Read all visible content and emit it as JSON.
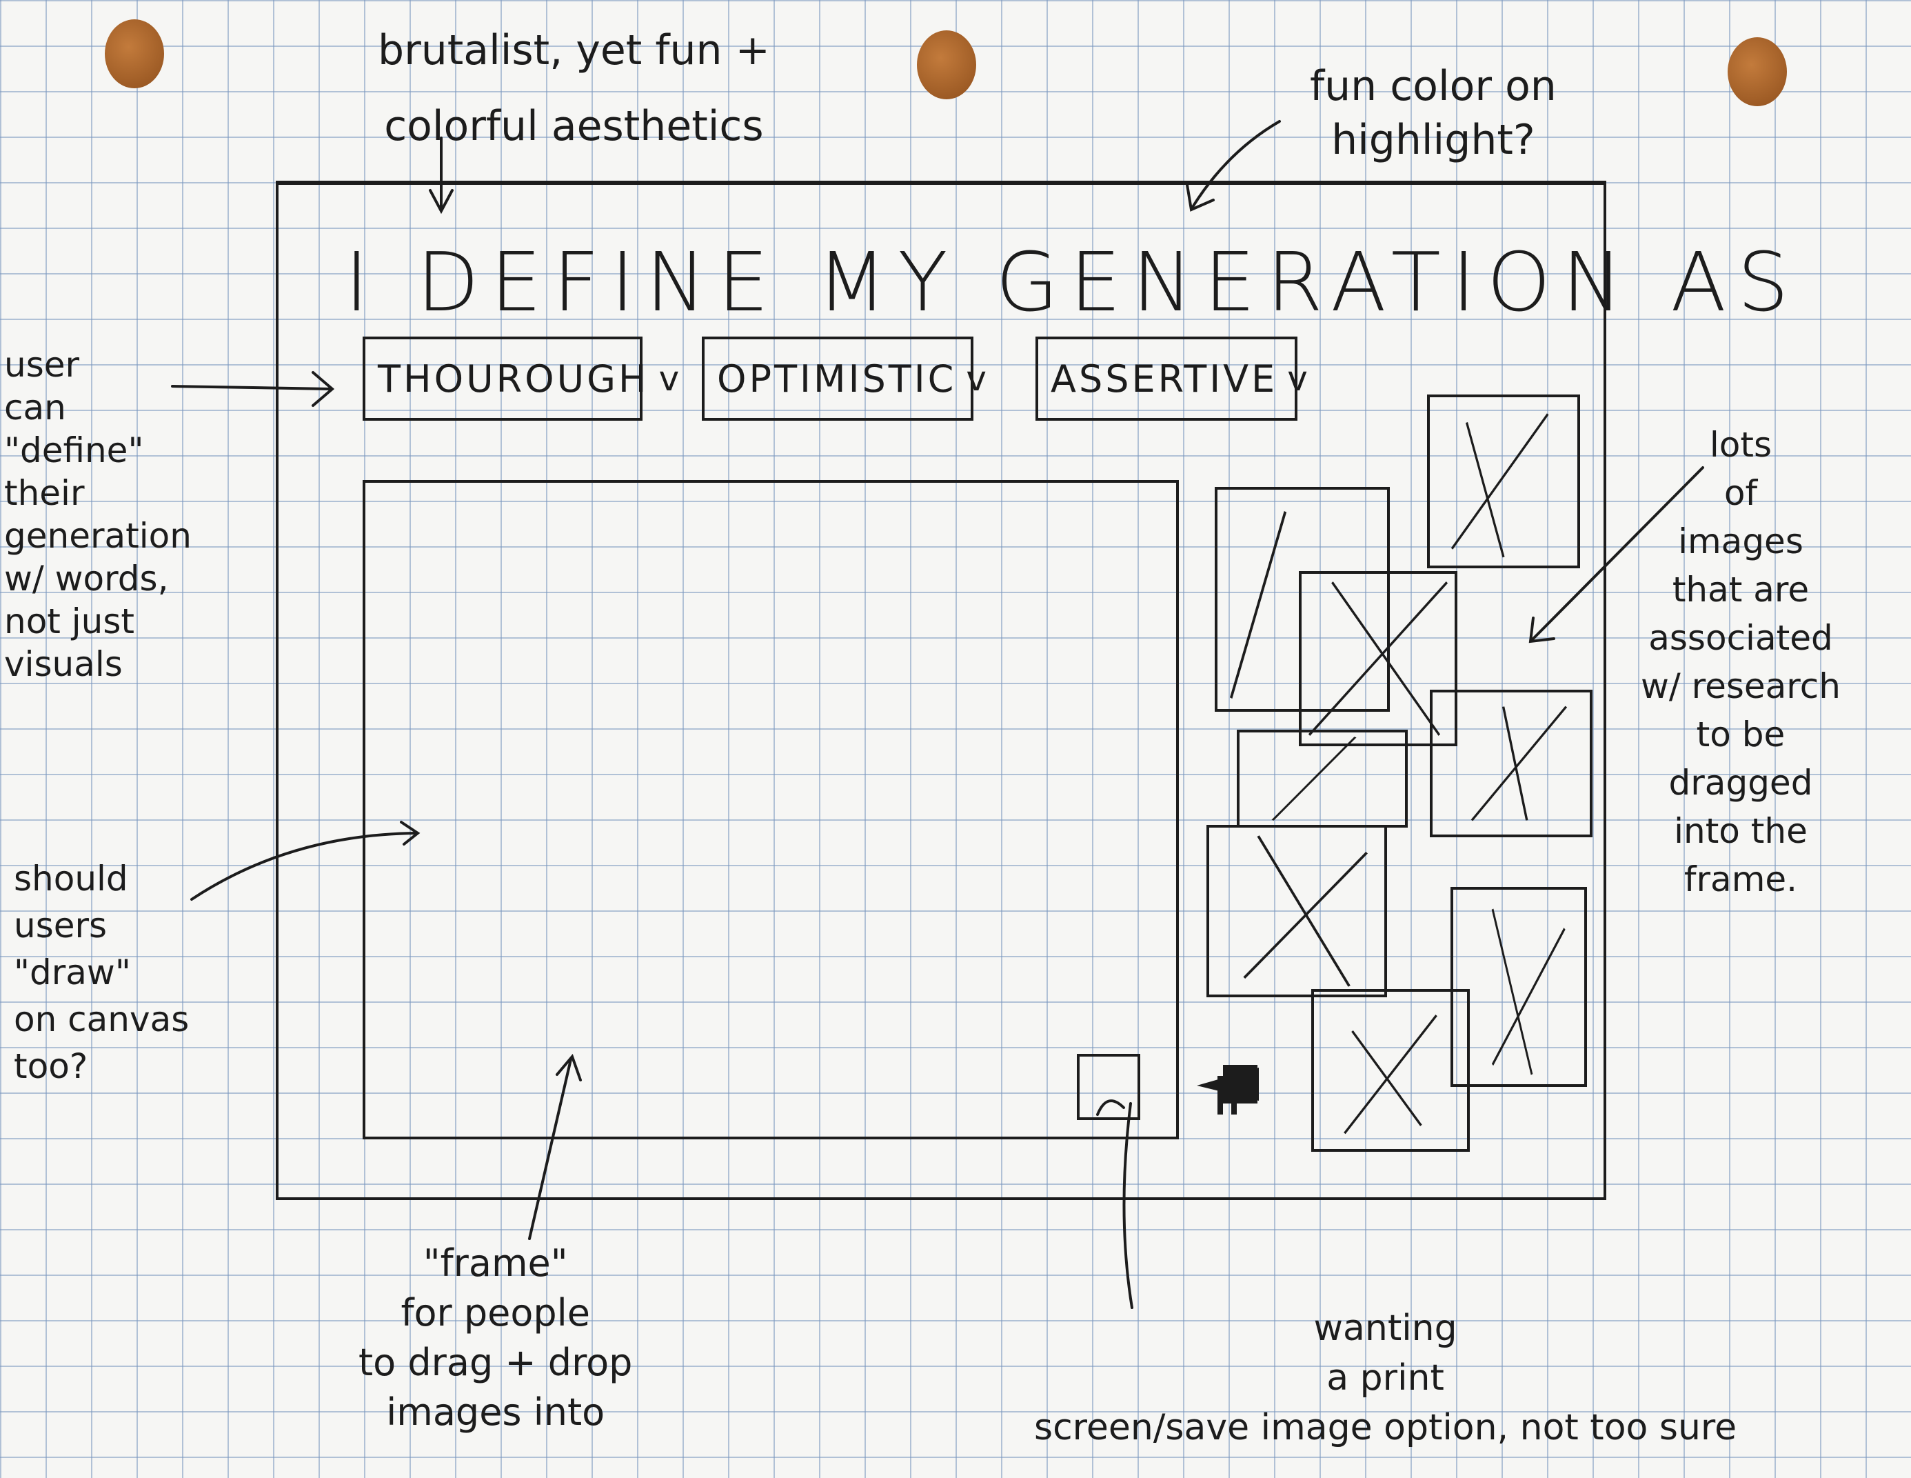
{
  "annotations": {
    "top_aesthetics": "brutalist, yet fun +\ncolorful aesthetics",
    "highlight_note": "fun color on\nhighlight?",
    "define_note": "user\ncan\n\"define\"\ntheir\ngeneration\nw/ words,\nnot just\nvisuals",
    "draw_note": "should\nusers\n\"draw\"\non canvas\ntoo?",
    "images_note": "lots\nof\nimages\nthat are\nassociated\nw/ research\nto be\ndragged\ninto the\nframe.",
    "frame_note": "\"frame\"\nfor people\nto drag + drop\nimages into",
    "print_note": "wanting\na print\nscreen/save image option, not too sure"
  },
  "app": {
    "heading": "I DEFINE MY GENERATION AS",
    "dropdowns": [
      {
        "label": "THOUROUGH",
        "chevron": "v"
      },
      {
        "label": "OPTIMISTIC",
        "chevron": "v"
      },
      {
        "label": "ASSERTIVE",
        "chevron": "v"
      }
    ]
  },
  "icons": {
    "pin": "pushpin-icon",
    "image_placeholder": "image-placeholder-icon",
    "arrow": "arrow-left-icon"
  },
  "colors": {
    "pin": "#a8622a",
    "ink": "#1c1c1c",
    "grid": "#7896be"
  }
}
